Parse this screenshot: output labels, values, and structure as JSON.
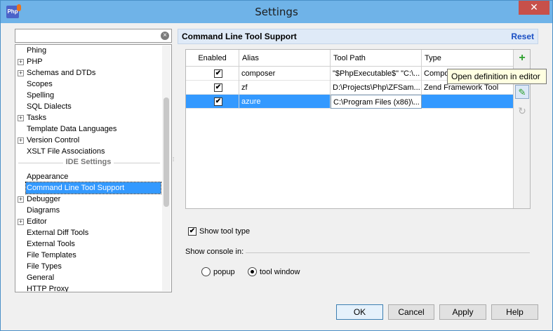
{
  "window": {
    "title": "Settings",
    "close_glyph": "✕",
    "app_icon_text": "Php"
  },
  "search": {
    "value": "",
    "placeholder": "",
    "clear_glyph": "×"
  },
  "tree": {
    "items": [
      {
        "label": "Phing",
        "expandable": false
      },
      {
        "label": "PHP",
        "expandable": true
      },
      {
        "label": "Schemas and DTDs",
        "expandable": true
      },
      {
        "label": "Scopes",
        "expandable": false
      },
      {
        "label": "Spelling",
        "expandable": false
      },
      {
        "label": "SQL Dialects",
        "expandable": false
      },
      {
        "label": "Tasks",
        "expandable": true
      },
      {
        "label": "Template Data Languages",
        "expandable": false
      },
      {
        "label": "Version Control",
        "expandable": true
      },
      {
        "label": "XSLT File Associations",
        "expandable": false
      }
    ],
    "group_header": "IDE Settings",
    "ide_items": [
      {
        "label": "Appearance",
        "expandable": false
      },
      {
        "label": "Command Line Tool Support",
        "expandable": false,
        "selected": true
      },
      {
        "label": "Debugger",
        "expandable": true
      },
      {
        "label": "Diagrams",
        "expandable": false
      },
      {
        "label": "Editor",
        "expandable": true
      },
      {
        "label": "External Diff Tools",
        "expandable": false
      },
      {
        "label": "External Tools",
        "expandable": false
      },
      {
        "label": "File Templates",
        "expandable": false
      },
      {
        "label": "File Types",
        "expandable": false
      },
      {
        "label": "General",
        "expandable": false
      },
      {
        "label": "HTTP Proxy",
        "expandable": false
      }
    ]
  },
  "panel": {
    "title": "Command Line Tool Support",
    "reset": "Reset"
  },
  "table": {
    "columns": [
      "Enabled",
      "Alias",
      "Tool Path",
      "Type"
    ],
    "rows": [
      {
        "enabled": true,
        "alias": "composer",
        "path": "\"$PhpExecutable$\" \"C:\\...",
        "type": "Composer"
      },
      {
        "enabled": true,
        "alias": "zf",
        "path": "D:\\Projects\\Php\\ZFSam...",
        "type": "Zend Framework Tool"
      },
      {
        "enabled": true,
        "alias": "azure",
        "path": "C:\\Program Files (x86)\\...",
        "type": "",
        "selected": true
      }
    ],
    "check_glyph": "✔"
  },
  "toolbar": {
    "add_icon": "add-icon",
    "edit_icon": "edit-icon",
    "refresh_icon": "refresh-icon"
  },
  "tooltip": "Open definition in editor",
  "options": {
    "show_tool_type": "Show tool type",
    "show_tool_type_checked": true
  },
  "console": {
    "label": "Show console in:",
    "options": [
      {
        "label": "popup",
        "checked": false
      },
      {
        "label": "tool window",
        "checked": true
      }
    ]
  },
  "buttons": {
    "ok": "OK",
    "cancel": "Cancel",
    "apply": "Apply",
    "help": "Help"
  }
}
